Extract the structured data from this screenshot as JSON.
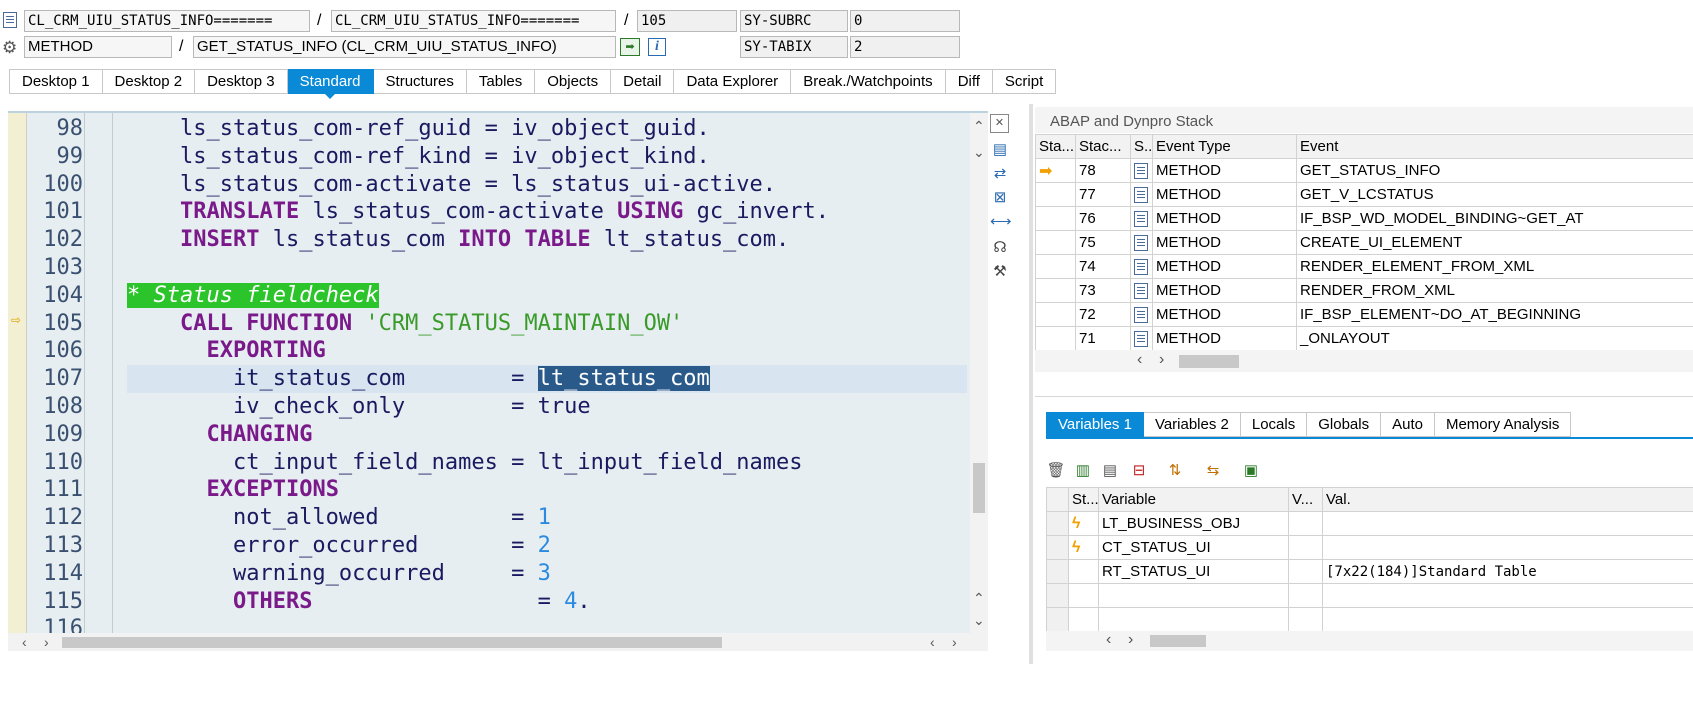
{
  "header": {
    "program_field": "CL_CRM_UIU_STATUS_INFO=======",
    "include_field": "CL_CRM_UIU_STATUS_INFO=======",
    "line_field": "105",
    "subrc_label": "SY-SUBRC",
    "subrc_value": "0",
    "event_type": "METHOD",
    "event_name": "GET_STATUS_INFO (CL_CRM_UIU_STATUS_INFO)",
    "tabix_label": "SY-TABIX",
    "tabix_value": "2",
    "sep": "/"
  },
  "tabs": [
    "Desktop 1",
    "Desktop 2",
    "Desktop 3",
    "Standard",
    "Structures",
    "Tables",
    "Objects",
    "Detail",
    "Data Explorer",
    "Break./Watchpoints",
    "Diff",
    "Script"
  ],
  "active_tab": "Standard",
  "code_lines": [
    {
      "n": "98",
      "segs": [
        {
          "t": "    ls_status_com-ref_guid = iv_object_guid.",
          "c": ""
        }
      ]
    },
    {
      "n": "99",
      "segs": [
        {
          "t": "    ls_status_com-ref_kind = iv_object_kind.",
          "c": ""
        }
      ]
    },
    {
      "n": "100",
      "segs": [
        {
          "t": "    ls_status_com-activate = ls_status_ui-active.",
          "c": ""
        }
      ]
    },
    {
      "n": "101",
      "segs": [
        {
          "t": "    ",
          "c": ""
        },
        {
          "t": "TRANSLATE",
          "c": "kw"
        },
        {
          "t": " ls_status_com-activate ",
          "c": ""
        },
        {
          "t": "USING",
          "c": "kw"
        },
        {
          "t": " gc_invert.",
          "c": ""
        }
      ]
    },
    {
      "n": "102",
      "segs": [
        {
          "t": "    ",
          "c": ""
        },
        {
          "t": "INSERT",
          "c": "kw"
        },
        {
          "t": " ls_status_com ",
          "c": ""
        },
        {
          "t": "INTO TABLE",
          "c": "kw"
        },
        {
          "t": " lt_status_com.",
          "c": ""
        }
      ]
    },
    {
      "n": "103",
      "segs": []
    },
    {
      "n": "104",
      "segs": [
        {
          "t": "* Status fieldcheck",
          "c": "cmt"
        }
      ]
    },
    {
      "n": "105",
      "segs": [
        {
          "t": "    ",
          "c": ""
        },
        {
          "t": "CALL FUNCTION",
          "c": "kw"
        },
        {
          "t": " ",
          "c": ""
        },
        {
          "t": "'CRM_STATUS_MAINTAIN_OW'",
          "c": "str"
        }
      ]
    },
    {
      "n": "106",
      "segs": [
        {
          "t": "      ",
          "c": ""
        },
        {
          "t": "EXPORTING",
          "c": "kw"
        }
      ]
    },
    {
      "n": "107",
      "segs": [
        {
          "t": "        it_status_com        = ",
          "c": ""
        },
        {
          "t": "lt_status_com",
          "c": "sel"
        }
      ],
      "hl": true
    },
    {
      "n": "108",
      "segs": [
        {
          "t": "        iv_check_only        = true",
          "c": ""
        }
      ]
    },
    {
      "n": "109",
      "segs": [
        {
          "t": "      ",
          "c": ""
        },
        {
          "t": "CHANGING",
          "c": "kw"
        }
      ]
    },
    {
      "n": "110",
      "segs": [
        {
          "t": "        ct_input_field_names = lt_input_field_names",
          "c": ""
        }
      ]
    },
    {
      "n": "111",
      "segs": [
        {
          "t": "      ",
          "c": ""
        },
        {
          "t": "EXCEPTIONS",
          "c": "kw"
        }
      ]
    },
    {
      "n": "112",
      "segs": [
        {
          "t": "        not_allowed          = ",
          "c": ""
        },
        {
          "t": "1",
          "c": "num"
        }
      ]
    },
    {
      "n": "113",
      "segs": [
        {
          "t": "        error_occurred       = ",
          "c": ""
        },
        {
          "t": "2",
          "c": "num"
        }
      ]
    },
    {
      "n": "114",
      "segs": [
        {
          "t": "        warning_occurred     = ",
          "c": ""
        },
        {
          "t": "3",
          "c": "num"
        }
      ]
    },
    {
      "n": "115",
      "segs": [
        {
          "t": "        ",
          "c": ""
        },
        {
          "t": "OTHERS",
          "c": "kw"
        },
        {
          "t": "                 = ",
          "c": ""
        },
        {
          "t": "4",
          "c": "num"
        },
        {
          "t": ".",
          "c": ""
        }
      ]
    },
    {
      "n": "116",
      "segs": []
    }
  ],
  "stack": {
    "title": "ABAP and Dynpro Stack",
    "headers": [
      "Sta...",
      "Stac...",
      "S..",
      "Event Type",
      "Event"
    ],
    "rows": [
      {
        "level": "78",
        "type": "METHOD",
        "event": "GET_STATUS_INFO",
        "current": true
      },
      {
        "level": "77",
        "type": "METHOD",
        "event": "GET_V_LCSTATUS"
      },
      {
        "level": "76",
        "type": "METHOD",
        "event": "IF_BSP_WD_MODEL_BINDING~GET_AT"
      },
      {
        "level": "75",
        "type": "METHOD",
        "event": "CREATE_UI_ELEMENT"
      },
      {
        "level": "74",
        "type": "METHOD",
        "event": "RENDER_ELEMENT_FROM_XML"
      },
      {
        "level": "73",
        "type": "METHOD",
        "event": "RENDER_FROM_XML"
      },
      {
        "level": "72",
        "type": "METHOD",
        "event": "IF_BSP_ELEMENT~DO_AT_BEGINNING"
      },
      {
        "level": "71",
        "type": "METHOD",
        "event": "_ONLAYOUT"
      }
    ]
  },
  "var_tabs": [
    "Variables 1",
    "Variables 2",
    "Locals",
    "Globals",
    "Auto",
    "Memory Analysis"
  ],
  "active_var_tab": "Variables 1",
  "variables": {
    "headers": [
      "St...",
      "Variable",
      "V...",
      "Val."
    ],
    "rows": [
      {
        "changed": true,
        "name": "LT_BUSINESS_OBJ",
        "value": ""
      },
      {
        "changed": true,
        "name": "CT_STATUS_UI",
        "value": ""
      },
      {
        "changed": false,
        "name": "RT_STATUS_UI",
        "value": "[7x22(184)]Standard Table"
      },
      {
        "changed": false,
        "name": "",
        "value": ""
      },
      {
        "changed": false,
        "name": "",
        "value": ""
      }
    ]
  },
  "icons": {
    "program": "document-icon",
    "method": "gear-icon",
    "navigate": "navigate-icon",
    "info": "info-icon",
    "current_line": "arrow-icon",
    "changed": "lightning-icon"
  },
  "colors": {
    "accent": "#0a8ad6",
    "keyword": "#7a1a8a",
    "string": "#3a9a2a",
    "number": "#2a8ae0",
    "comment_bg": "#2bc42b"
  }
}
